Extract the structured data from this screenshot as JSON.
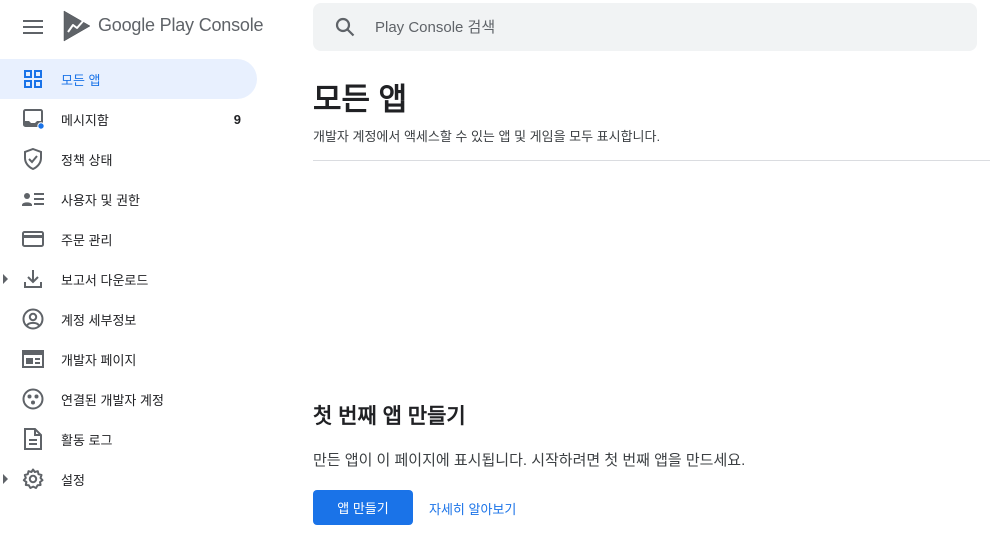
{
  "app": {
    "brand_google": "Google Play",
    "brand_console": "Console"
  },
  "search": {
    "placeholder": "Play Console 검색",
    "value": ""
  },
  "sidebar": {
    "items": [
      {
        "label": "모든 앱",
        "icon": "grid-icon",
        "active": true
      },
      {
        "label": "메시지함",
        "icon": "inbox-icon",
        "count": "9"
      },
      {
        "label": "정책 상태",
        "icon": "shield-check-icon"
      },
      {
        "label": "사용자 및 권한",
        "icon": "people-list-icon"
      },
      {
        "label": "주문 관리",
        "icon": "credit-card-icon"
      },
      {
        "label": "보고서 다운로드",
        "icon": "download-icon",
        "expandable": true
      },
      {
        "label": "계정 세부정보",
        "icon": "account-circle-icon"
      },
      {
        "label": "개발자 페이지",
        "icon": "web-page-icon"
      },
      {
        "label": "연결된 개발자 계정",
        "icon": "linked-accounts-icon"
      },
      {
        "label": "활동 로그",
        "icon": "document-icon"
      },
      {
        "label": "설정",
        "icon": "gear-icon",
        "expandable": true
      }
    ]
  },
  "main": {
    "title": "모든 앱",
    "subtitle": "개발자 계정에서 액세스할 수 있는 앱 및 게임을 모두 표시합니다.",
    "empty_title": "첫 번째 앱 만들기",
    "empty_desc": "만든 앱이 이 페이지에 표시됩니다. 시작하려면 첫 번째 앱을 만드세요.",
    "create_label": "앱 만들기",
    "learn_label": "자세히 알아보기"
  },
  "colors": {
    "accent": "#1a73e8",
    "active_bg": "#e8f0fe",
    "icon": "#5f6368",
    "notification_dot": "#1a73e8"
  }
}
